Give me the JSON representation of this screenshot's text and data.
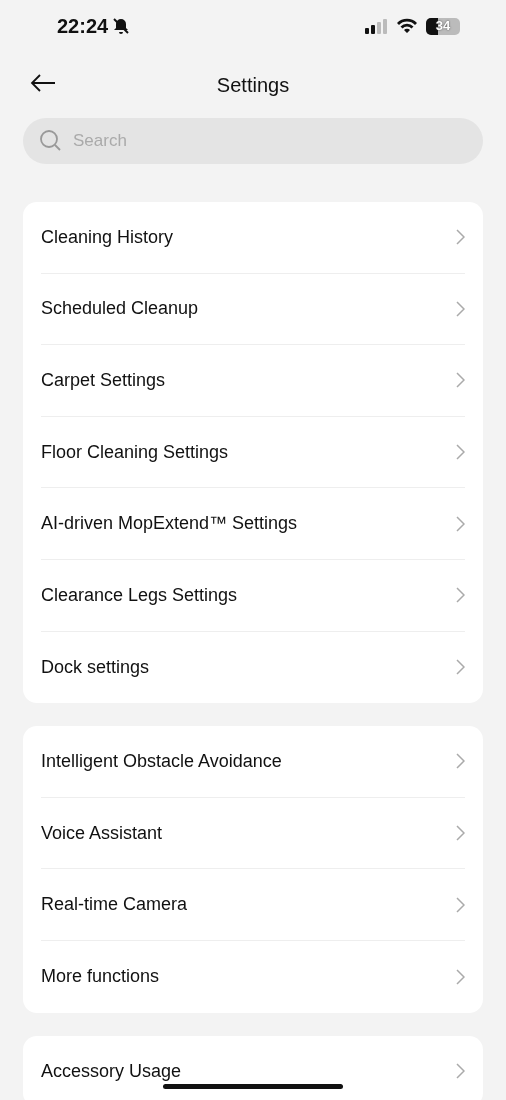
{
  "status_bar": {
    "time": "22:24",
    "battery": {
      "text": "34",
      "level": 0.34
    }
  },
  "header": {
    "title": "Settings"
  },
  "search": {
    "placeholder": "Search"
  },
  "groups": [
    {
      "items": [
        "Cleaning History",
        "Scheduled Cleanup",
        "Carpet Settings",
        "Floor Cleaning Settings",
        "AI-driven MopExtend™ Settings",
        "Clearance Legs Settings",
        "Dock settings"
      ]
    },
    {
      "items": [
        "Intelligent Obstacle Avoidance",
        "Voice Assistant",
        "Real-time Camera",
        "More functions"
      ]
    },
    {
      "items": [
        "Accessory Usage"
      ]
    }
  ]
}
